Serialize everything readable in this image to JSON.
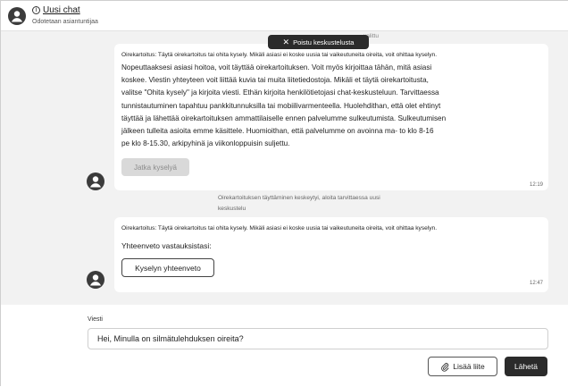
{
  "header": {
    "title": "Uusi chat",
    "subtitle": "Odotetaan asiantuntijaa",
    "info_icon": "info-icon",
    "avatar_icon": "user-avatar-icon"
  },
  "chat": {
    "faded_top_text": "valittu",
    "leave_button": "Poistu keskustelusta",
    "messages": [
      {
        "intro": "Oirekartoitus: Täytä oirekartoitus tai ohita kysely. Mikäli asiasi ei koske uusia tai vaikeutuneita oireita, voit ohittaa kyselyn.",
        "body_lines": [
          "Nopeuttaaksesi asiasi hoitoa, voit täyttää oirekartoituksen. Voit myös kirjoittaa tähän, mitä asiasi",
          "koskee. Viestin yhteyteen voit liittää kuvia tai muita liitetiedostoja. Mikäli et täytä oirekartoitusta,",
          "valitse \"Ohita kysely\" ja kirjoita viesti. Ethän kirjoita henkilötietojasi chat-keskusteluun. Tarvittaessa",
          "tunnistautuminen tapahtuu pankkitunnuksilla tai mobiilivarmenteella. Huolehdithan, että olet ehtinyt",
          "täyttää ja lähettää oirekartoituksen ammattilaiselle ennen palvelumme sulkeutumista. Sulkeutumisen",
          "jälkeen tulleita asioita emme käsittele. Huomioithan, että palvelumme on avoinna ma- to klo 8-16",
          "pe klo 8-15.30, arkipyhinä ja viikonloppuisin suljettu."
        ],
        "button": "Jatka kyselyä",
        "time": "12:19"
      },
      {
        "intro": "Oirekartoitus: Täytä oirekartoitus tai ohita kysely. Mikäli asiasi ei koske uusia tai vaikeutuneita oireita, voit ohittaa kyselyn.",
        "summary_label": "Yhteenveto vastauksistasi:",
        "button": "Kyselyn yhteenveto",
        "time": "12:47"
      }
    ],
    "status_note_lines": [
      "Oirekartoituksen täyttäminen keskeytyi, aloita tarvittaessa uusi",
      "keskustelu"
    ]
  },
  "composer": {
    "label": "Viesti",
    "input_value": "Hei, Minulla on silmätulehduksen oireita?",
    "attach_button": "Lisää liite",
    "send_button": "Lähetä"
  },
  "colors": {
    "dark_button": "#2b2b2b",
    "chat_background": "#f2f2f2",
    "disabled_button": "#d9d9d9"
  }
}
